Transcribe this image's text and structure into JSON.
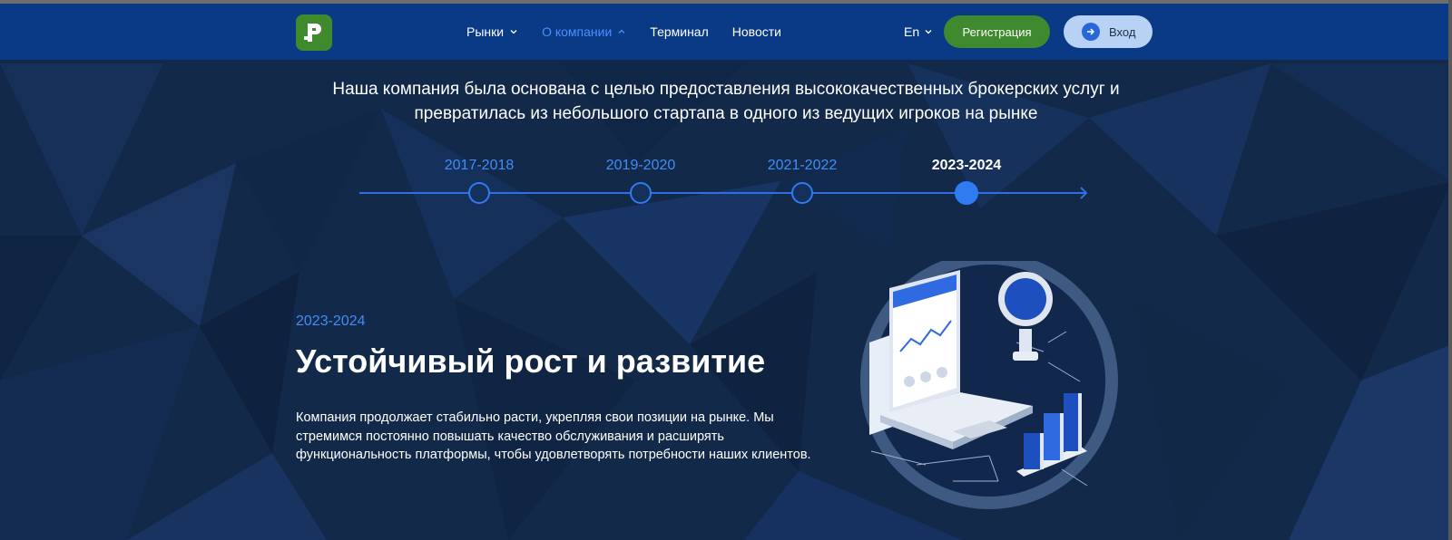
{
  "colors": {
    "header_bg": "#0a3a85",
    "page_bg": "#13294a",
    "accent_blue": "#2f7bf2",
    "brand_green": "#3f8a2e",
    "login_bg": "#b8d2f6"
  },
  "header": {
    "logo_icon": "brand-logo-icon",
    "nav": [
      {
        "label": "Рынки",
        "has_dropdown": true,
        "active": false
      },
      {
        "label": "О компании",
        "has_dropdown": true,
        "active": true
      },
      {
        "label": "Терминал",
        "has_dropdown": false,
        "active": false
      },
      {
        "label": "Новости",
        "has_dropdown": false,
        "active": false
      }
    ],
    "language": "En",
    "register_label": "Регистрация",
    "login_label": "Вход",
    "login_icon": "login-arrow-icon"
  },
  "intro": {
    "subtitle_line1": "Наша компания была основана с целью предоставления высококачественных брокерских услуг и",
    "subtitle_line2": "превратилась из небольшого стартапа в одного из ведущих игроков на рынке"
  },
  "timeline": {
    "periods": [
      "2017-2018",
      "2019-2020",
      "2021-2022",
      "2023-2024"
    ],
    "active_index": 3
  },
  "section": {
    "period": "2023-2024",
    "title": "Устойчивый рост и развитие",
    "text_line1": "Компания продолжает стабильно расти, укрепляя свои позиции на рынке. Мы",
    "text_line2": "стремимся постоянно повышать качество обслуживания и расширять",
    "text_line3": "функциональность платформы, чтобы удовлетворять потребности наших клиентов."
  }
}
